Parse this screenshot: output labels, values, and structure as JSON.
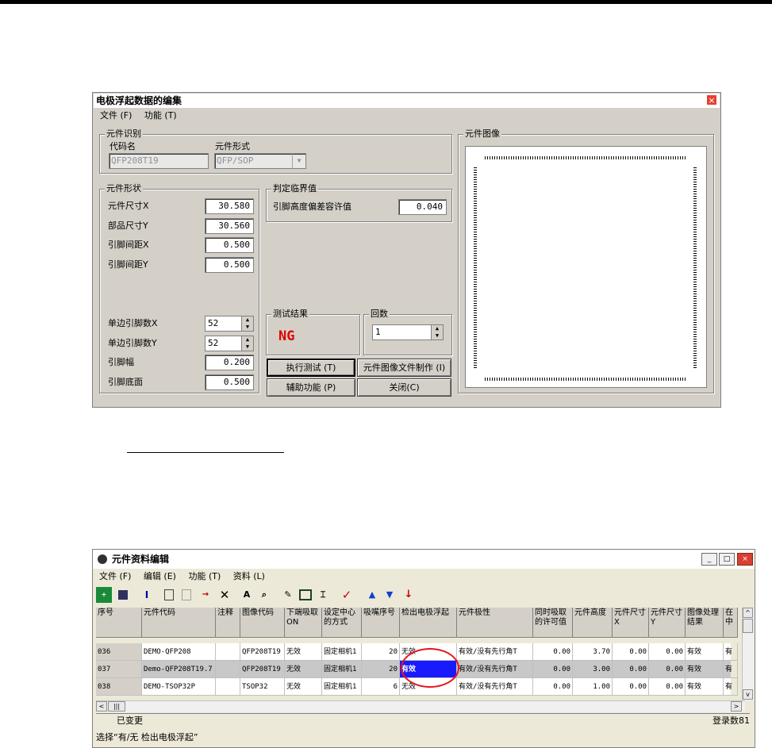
{
  "window1": {
    "title": "电极浮起数据的编集",
    "close_glyph": "×",
    "menu": [
      "文件 (F)",
      "功能 (T)"
    ],
    "part_id": {
      "group_label": "元件识别",
      "code_label": "代码名",
      "code_value": "QFP208T19",
      "type_label": "元件形式",
      "type_value": "QFP/SOP"
    },
    "shape": {
      "group_label": "元件形状",
      "size_x_label": "元件尺寸X",
      "size_x": "30.580",
      "size_y_label": "部品尺寸Y",
      "size_y": "30.560",
      "pitch_x_label": "引脚间距X",
      "pitch_x": "0.500",
      "pitch_y_label": "引脚间距Y",
      "pitch_y": "0.500",
      "pins_x_label": "单边引脚数X",
      "pins_x": "52",
      "pins_y_label": "单边引脚数Y",
      "pins_y": "52",
      "lead_width_label": "引脚幅",
      "lead_width": "0.200",
      "lead_bottom_label": "引脚底面",
      "lead_bottom": "0.500"
    },
    "threshold": {
      "group_label": "判定临界值",
      "tolerance_label": "引脚高度偏差容许值",
      "tolerance": "0.040"
    },
    "test_result": {
      "group_label": "测试结果",
      "value": "NG"
    },
    "count": {
      "group_label": "回数",
      "value": "1"
    },
    "buttons": {
      "run_test": "执行测试 (T)",
      "make_image": "元件图像文件制作 (I)",
      "aux": "辅助功能 (P)",
      "close": "关闭(C)"
    },
    "image_group_label": "元件图像",
    "accent_ng": "#e00000"
  },
  "window2": {
    "title": "元件资料编辑",
    "menu": [
      "文件 (F)",
      "编辑 (E)",
      "功能 (T)",
      "资料 (L)"
    ],
    "columns": [
      "序号",
      "元件代码",
      "注释",
      "图像代码",
      "下端吸取ON",
      "设定中心的方式",
      "吸嘴序号",
      "检出电极浮起",
      "元件极性",
      "同时吸取的许可值",
      "元件高度",
      "元件尺寸X",
      "元件尺寸Y",
      "图像处理结果",
      "在中"
    ],
    "rows": [
      [
        "036",
        "DEMO-QFP208",
        "",
        "QFP208T19",
        "无效",
        "固定相机1",
        "20",
        "无效",
        "有效/没有先行角T",
        "0.00",
        "3.70",
        "0.00",
        "0.00",
        "有效",
        "有"
      ],
      [
        "037",
        "Demo-QFP208T19.7",
        "",
        "QFP208T19",
        "无效",
        "固定相机1",
        "20",
        "有效",
        "有效/没有先行角T",
        "0.00",
        "3.00",
        "0.00",
        "0.00",
        "有效",
        "有"
      ],
      [
        "038",
        "DEMO-TSOP32P",
        "",
        "TSOP32",
        "无效",
        "固定相机1",
        "6",
        "无效",
        "有效/没有先行角T",
        "0.00",
        "1.00",
        "0.00",
        "0.00",
        "有效",
        "有"
      ]
    ],
    "selected_row": 1,
    "status_changed": "已变更",
    "record_count": "登录数81",
    "hint": "选择“有/无 检出电极浮起”",
    "selection_color": "#1a1aff",
    "circle_color": "#e8141c",
    "title_buttons": {
      "min": "_",
      "max": "□",
      "close": "×"
    },
    "scroll": {
      "left": "<",
      "right": ">",
      "up": "^",
      "down": "v",
      "thumb": "|||"
    }
  }
}
